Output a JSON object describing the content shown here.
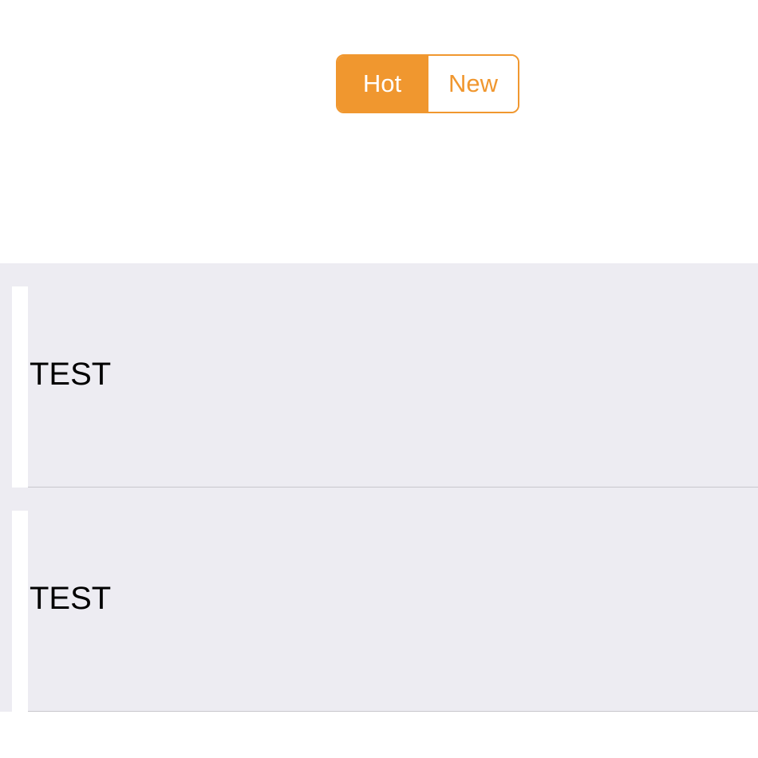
{
  "segmented_control": {
    "options": [
      {
        "label": "Hot",
        "selected": true
      },
      {
        "label": "New",
        "selected": false
      }
    ],
    "accent_color": "#f0972f"
  },
  "list": {
    "background_color": "#edecf2",
    "rows": [
      {
        "label": "TEST"
      },
      {
        "label": "TEST"
      }
    ]
  }
}
